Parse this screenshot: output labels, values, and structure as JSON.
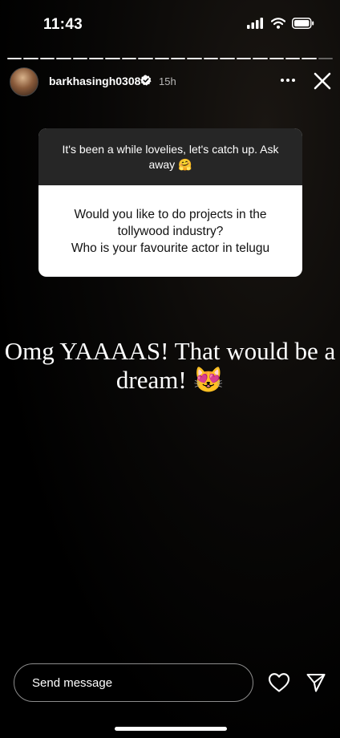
{
  "status_bar": {
    "time": "11:43",
    "icons": [
      "signal-icon",
      "wifi-icon",
      "battery-icon"
    ]
  },
  "story": {
    "segments_total": 20,
    "segments_viewed": 19,
    "username": "barkhasingh0308",
    "verified": true,
    "time_ago": "15h",
    "more_icon": "more-dots-icon",
    "close_icon": "close-icon"
  },
  "question_sticker": {
    "prompt": "It's been a while lovelies, let's catch up. Ask away 🤗",
    "question": "Would you like to do projects in the tollywood industry?\nWho is your favourite actor in telugu"
  },
  "answer_text": "Omg YAAAAS! That would be a dream! 😻",
  "composer": {
    "placeholder": "Send message",
    "heart_icon": "heart-icon",
    "send_icon": "send-icon"
  },
  "colors": {
    "background": "#000000",
    "sticker_header": "#262626",
    "sticker_body": "#ffffff"
  }
}
